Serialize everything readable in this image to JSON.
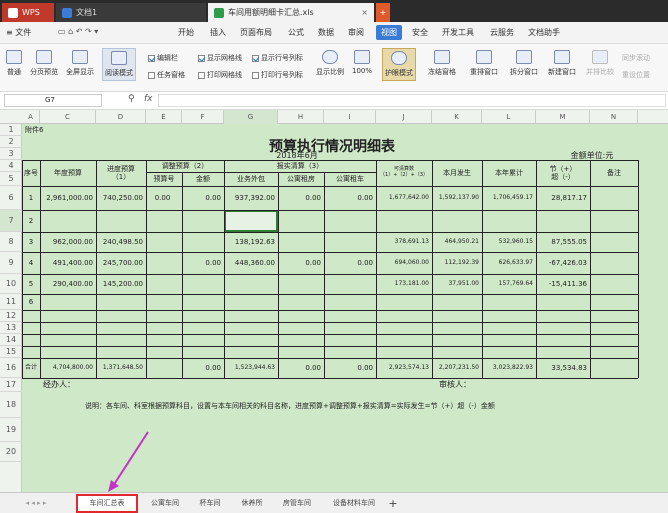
{
  "tabs": {
    "app": "WPS",
    "doc1": "文档1",
    "active": "车间用额明细卡汇总.xls",
    "add": "+"
  },
  "menu": [
    "≡ 文件",
    "开始",
    "插入",
    "页面布局",
    "公式",
    "数据",
    "审阅",
    "视图",
    "安全",
    "开发工具",
    "云服务",
    "文档助手"
  ],
  "menu_active": "视图",
  "ribbon": {
    "normal": "普通",
    "page_break": "分页预览",
    "full_screen": "全屏显示",
    "reading": "阅读模式",
    "chk_editbar": "编辑栏",
    "chk_taskpane": "任务窗格",
    "chk_gridlines": "显示网格线",
    "chk_print_grid": "打印网格线",
    "chk_rowcol": "显示行号列标",
    "chk_print_rowcol": "打印行号列标",
    "zoom_label": "显示比例",
    "zoom_value": "100%",
    "eye_mode": "护眼模式",
    "freeze": "冻结窗格",
    "rearrange": "重排窗口",
    "split": "拆分窗口",
    "new_window": "新建窗口",
    "side_by_side": "并排比较",
    "sync_scroll": "同步滚动",
    "reset_pos": "重设位置"
  },
  "namebox": "G7",
  "fx": "fx",
  "columns": [
    "A",
    "C",
    "D",
    "E",
    "F",
    "G",
    "H",
    "I",
    "J",
    "K",
    "L",
    "M",
    "N"
  ],
  "rows": [
    "1",
    "2",
    "3",
    "4",
    "5",
    "6",
    "7",
    "8",
    "9",
    "10",
    "11",
    "12",
    "13",
    "14",
    "15",
    "16",
    "17",
    "18",
    "19",
    "20"
  ],
  "sheet": {
    "attachment": "附件6",
    "title": "预算执行情况明细表",
    "date": "2018年6月",
    "unit": "金额单位:元",
    "h_seq": "序号",
    "h_annual": "年度预算",
    "h_progress": "进度预算\n（1）",
    "h_adjust": "调整预算（2）",
    "h_adj_no": "预算号",
    "h_adj_amt": "金额",
    "h_claim": "报实清算（3）",
    "h_outsourcing": "业务外包",
    "h_rent": "公寓租房",
    "h_car": "公寓租车",
    "h_available": "可清算数（1）+（2）+（3）",
    "h_month": "本月发生",
    "h_year": "本年累计",
    "h_savings": "节（+）\n超（-）",
    "h_remark": "备注",
    "data_rows": [
      {
        "seq": "1",
        "annual": "2,961,000.00",
        "progress": "740,250.00",
        "adj_no": "0.00",
        "adj_amt": "0.00",
        "out": "937,392.00",
        "rent": "0.00",
        "car": "0.00",
        "avail": "1,677,642.00",
        "month": "1,592,137.90",
        "year": "1,706,459.17",
        "save": "28,817.17"
      },
      {
        "seq": "2",
        "annual": "",
        "progress": "",
        "adj_no": "",
        "adj_amt": "",
        "out": "",
        "rent": "",
        "car": "",
        "avail": "",
        "month": "",
        "year": "",
        "save": ""
      },
      {
        "seq": "3",
        "annual": "962,000.00",
        "progress": "240,498.50",
        "adj_no": "",
        "adj_amt": "",
        "out": "138,192.63",
        "rent": "",
        "car": "",
        "avail": "378,691.13",
        "month": "464,950.21",
        "year": "532,960.15",
        "save": "87,555.05"
      },
      {
        "seq": "4",
        "annual": "491,400.00",
        "progress": "245,700.00",
        "adj_no": "",
        "adj_amt": "0.00",
        "out": "448,360.00",
        "rent": "0.00",
        "car": "0.00",
        "avail": "694,060.00",
        "month": "112,192.39",
        "year": "626,633.97",
        "save": "-67,426.03"
      },
      {
        "seq": "5",
        "annual": "290,400.00",
        "progress": "145,200.00",
        "adj_no": "",
        "adj_amt": "",
        "out": "",
        "rent": "",
        "car": "",
        "avail": "173,181.00",
        "month": "37,951.00",
        "year": "157,769.64",
        "save": "-15,411.36"
      },
      {
        "seq": "6",
        "annual": "",
        "progress": "",
        "adj_no": "",
        "adj_amt": "",
        "out": "",
        "rent": "",
        "car": "",
        "avail": "",
        "month": "",
        "year": "",
        "save": ""
      }
    ],
    "total": {
      "seq": "合计",
      "annual": "4,704,800.00",
      "progress": "1,371,648.50",
      "adj_amt": "0.00",
      "out": "1,523,944.63",
      "rent": "0.00",
      "car": "0.00",
      "avail": "2,923,574.13",
      "month": "2,207,231.50",
      "year": "3,023,822.93",
      "save": "33,534.83"
    },
    "handler": "经办人：",
    "reviewer": "审核人：",
    "note": "说明：各车间、科室根据预算科目，设置与本车间相关的科目名称，进度预算+调整预算+报实清算=实际发生=节（+）超（-）金额"
  },
  "sheet_tabs": [
    "车间汇总表",
    "公寓车间",
    "杯车间",
    "休养所",
    "房管车间",
    "设备材料车间"
  ],
  "sheet_tab_add": "+",
  "colors": {
    "sheet_bg": "#cfe8c8",
    "active_tab_border": "#e0282e",
    "arrow": "#c235c8",
    "ribbon_active": "#3a7bd5"
  }
}
